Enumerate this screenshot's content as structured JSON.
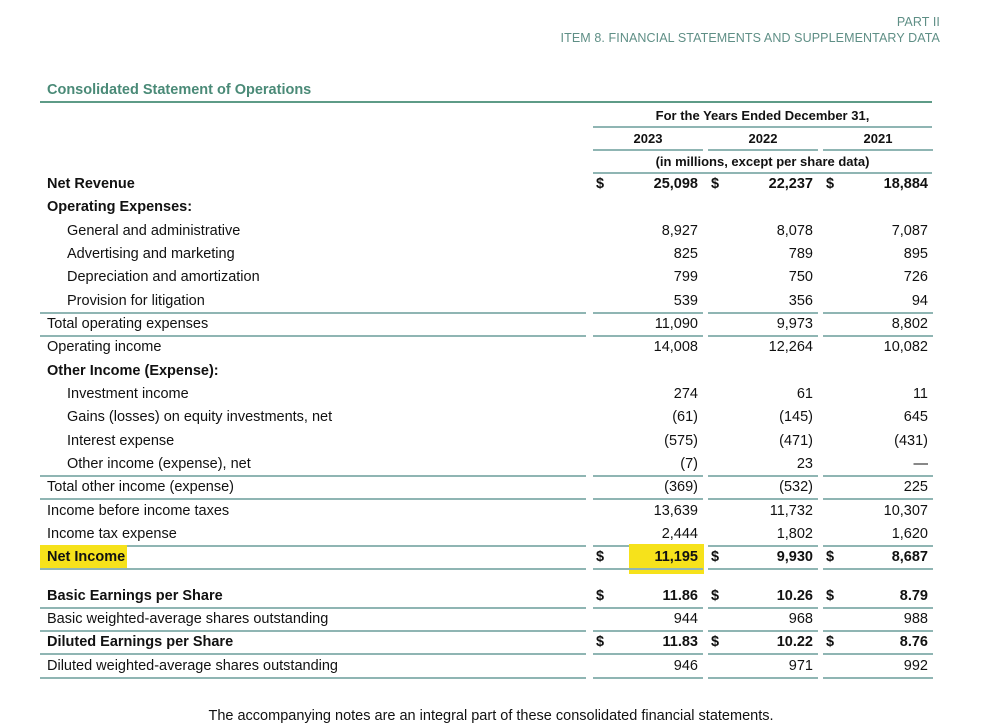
{
  "header": {
    "part": "PART II",
    "item": "ITEM 8. FINANCIAL STATEMENTS AND SUPPLEMENTARY DATA"
  },
  "statement": {
    "title": "Consolidated Statement of Operations",
    "period_header": "For the Years Ended December 31,",
    "years": [
      "2023",
      "2022",
      "2021"
    ],
    "units_note": "(in millions, except per share data)",
    "currency_symbol": "$",
    "highlight_color": "#f6e21b",
    "accent_color": "#4a8a77",
    "rows": [
      {
        "label": "Net Revenue",
        "values": [
          "25,098",
          "22,237",
          "18,884"
        ],
        "bold": true,
        "currency": true
      },
      {
        "label": "Operating Expenses:",
        "values": [
          "",
          "",
          ""
        ],
        "bold": true
      },
      {
        "label": "General and administrative",
        "values": [
          "8,927",
          "8,078",
          "7,087"
        ],
        "indent": true
      },
      {
        "label": "Advertising and marketing",
        "values": [
          "825",
          "789",
          "895"
        ],
        "indent": true
      },
      {
        "label": "Depreciation and amortization",
        "values": [
          "799",
          "750",
          "726"
        ],
        "indent": true
      },
      {
        "label": "Provision for litigation",
        "values": [
          "539",
          "356",
          "94"
        ],
        "indent": true
      },
      {
        "label": "Total operating expenses",
        "values": [
          "11,090",
          "9,973",
          "8,802"
        ]
      },
      {
        "label": "Operating income",
        "values": [
          "14,008",
          "12,264",
          "10,082"
        ]
      },
      {
        "label": "Other Income (Expense):",
        "values": [
          "",
          "",
          ""
        ],
        "bold": true
      },
      {
        "label": "Investment income",
        "values": [
          "274",
          "61",
          "11"
        ],
        "indent": true
      },
      {
        "label": "Gains (losses) on equity investments, net",
        "values": [
          "(61)",
          "(145)",
          "645"
        ],
        "indent": true
      },
      {
        "label": "Interest expense",
        "values": [
          "(575)",
          "(471)",
          "(431)"
        ],
        "indent": true
      },
      {
        "label": "Other income (expense), net",
        "values": [
          "(7)",
          "23",
          "—"
        ],
        "indent": true
      },
      {
        "label": "Total other income (expense)",
        "values": [
          "(369)",
          "(532)",
          "225"
        ]
      },
      {
        "label": "Income before income taxes",
        "values": [
          "13,639",
          "11,732",
          "10,307"
        ]
      },
      {
        "label": "Income tax expense",
        "values": [
          "2,444",
          "1,802",
          "1,620"
        ]
      },
      {
        "label": "Net Income",
        "values": [
          "11,195",
          "9,930",
          "8,687"
        ],
        "bold": true,
        "currency": true,
        "highlighted": true
      },
      {
        "label": "Basic Earnings per Share",
        "values": [
          "11.86",
          "10.26",
          "8.79"
        ],
        "bold": true,
        "currency": true
      },
      {
        "label": "Basic weighted-average shares outstanding",
        "values": [
          "944",
          "968",
          "988"
        ]
      },
      {
        "label": "Diluted Earnings per Share",
        "values": [
          "11.83",
          "10.22",
          "8.76"
        ],
        "bold": true,
        "currency": true
      },
      {
        "label": "Diluted weighted-average shares outstanding",
        "values": [
          "946",
          "971",
          "992"
        ]
      }
    ]
  },
  "footer": "The accompanying notes are an integral part of these consolidated financial statements."
}
